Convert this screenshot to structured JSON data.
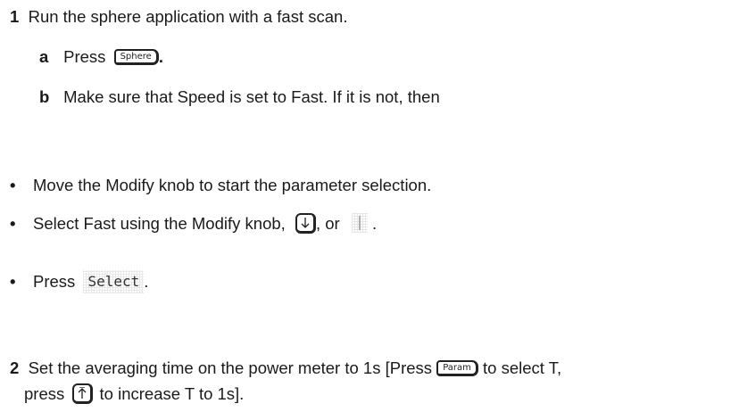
{
  "step1": {
    "number": "1",
    "text": "Run the sphere application with a fast scan."
  },
  "step1a": {
    "letter": "a",
    "press": "Press",
    "key_label": "Sphere"
  },
  "step1b": {
    "letter": "b",
    "text": "Make sure that Speed is set to Fast. If it is not, then"
  },
  "bullets": {
    "marker": "•",
    "b1": "Move the Modify knob to start the parameter selection.",
    "b2_text": "Select Fast using the Modify knob,",
    "b2_or": ", or",
    "b2_end": ".",
    "b3_press": "Press",
    "b3_softkey": "Select",
    "b3_end": "."
  },
  "step2": {
    "number": "2",
    "text_pre": "Set the averaging time on the power meter to 1s [Press",
    "key_label": "Param",
    "text_post": "to select T,",
    "line2_pre": "press",
    "line2_post": "to increase T to 1s]."
  },
  "icons": {
    "down_arrow_key": "down-arrow-key-icon",
    "knob_marker": "knob-icon",
    "up_arrow_key": "up-arrow-key-icon"
  }
}
